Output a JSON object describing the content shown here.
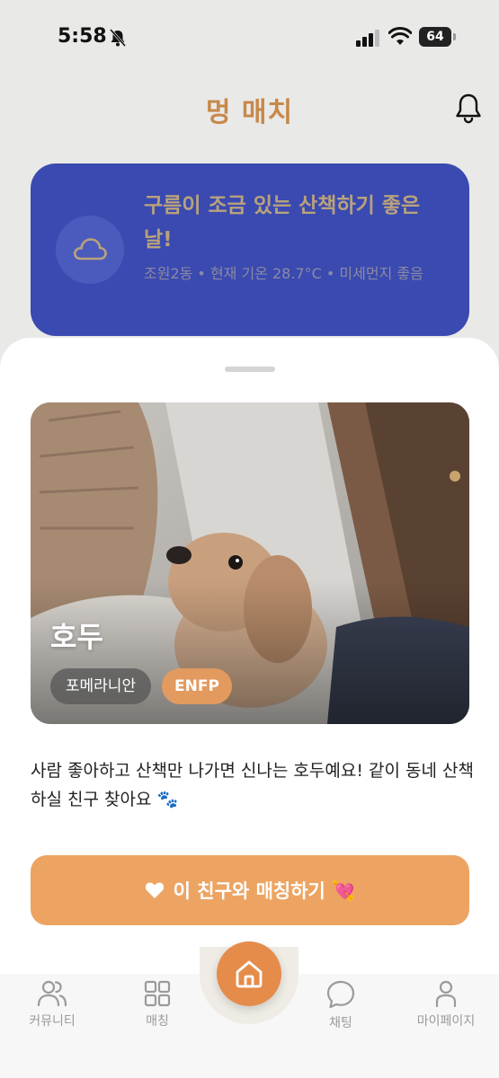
{
  "status_bar": {
    "time": "5:58",
    "battery": "64",
    "icons": [
      "bell-slash-icon",
      "signal-icon",
      "wifi-icon",
      "battery-icon"
    ]
  },
  "header": {
    "title": "멍 매치",
    "notification_icon": "bell-icon"
  },
  "weather": {
    "icon": "cloud-icon",
    "title": "구름이 조금 있는 산책하기 좋은 날!",
    "subtitle": "조원2동 • 현재 기온 28.7°C • 미세먼지 좋음"
  },
  "profile": {
    "name": "호두",
    "breed": "포메라니안",
    "mbti": "ENFP",
    "intro": "사람 좋아하고 산책만 나가면 신나는 호두예요! 같이 동네 산책하실 친구 찾아요 🐾",
    "match_button": "이 친구와 매칭하기 💘"
  },
  "tab_bar": {
    "items": [
      {
        "label": "커뮤니티",
        "icon": "users-icon"
      },
      {
        "label": "매칭",
        "icon": "grid-icon"
      },
      {
        "label": "",
        "icon": "home-icon"
      },
      {
        "label": "채팅",
        "icon": "chat-bubble-icon"
      },
      {
        "label": "마이페이지",
        "icon": "person-icon"
      }
    ]
  },
  "colors": {
    "accent": "#eda463",
    "home_button": "#e58c4b",
    "weather_card": "#3a4ab0",
    "title": "#c7884a"
  }
}
